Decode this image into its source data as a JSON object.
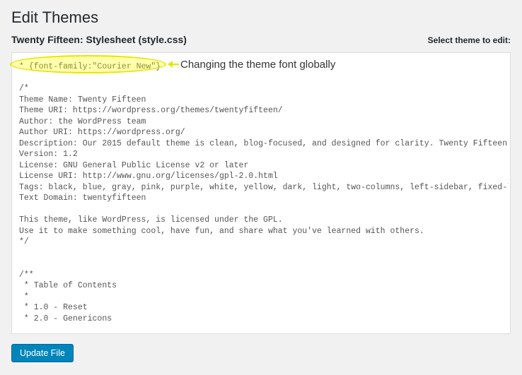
{
  "page_title": "Edit Themes",
  "file_title": "Twenty Fifteen: Stylesheet (style.css)",
  "select_theme_label": "Select theme to edit:",
  "annotation_text": "Changing the theme font globally",
  "update_button_label": "Update File",
  "code": "* {font-family:\"Courier New\"}\n\n/*\nTheme Name: Twenty Fifteen\nTheme URI: https://wordpress.org/themes/twentyfifteen/\nAuthor: the WordPress team\nAuthor URI: https://wordpress.org/\nDescription: Our 2015 default theme is clean, blog-focused, and designed for clarity. Twenty Fifteen's simple, straightforward typography is readable on a wide variety of screen sizes, and suitable for multiple languages. We designed it using a mobile-first approach, meaning your content takes center-stage, regardless of whether your visitors arrive by smartphone, tablet, laptop, or desktop computer.\nVersion: 1.2\nLicense: GNU General Public License v2 or later\nLicense URI: http://www.gnu.org/licenses/gpl-2.0.html\nTags: black, blue, gray, pink, purple, white, yellow, dark, light, two-columns, left-sidebar, fixed-layout, responsive-layout, accessibility-ready, custom-background, custom-colors, custom-header, custom-menu, editor-style, featured-images, microformats, post-formats, rtl-language-support, sticky-post, threaded-comments, translation-ready\nText Domain: twentyfifteen\n\nThis theme, like WordPress, is licensed under the GPL.\nUse it to make something cool, have fun, and share what you've learned with others.\n*/\n\n\n/**\n * Table of Contents\n *\n * 1.0 - Reset\n * 2.0 - Genericons"
}
